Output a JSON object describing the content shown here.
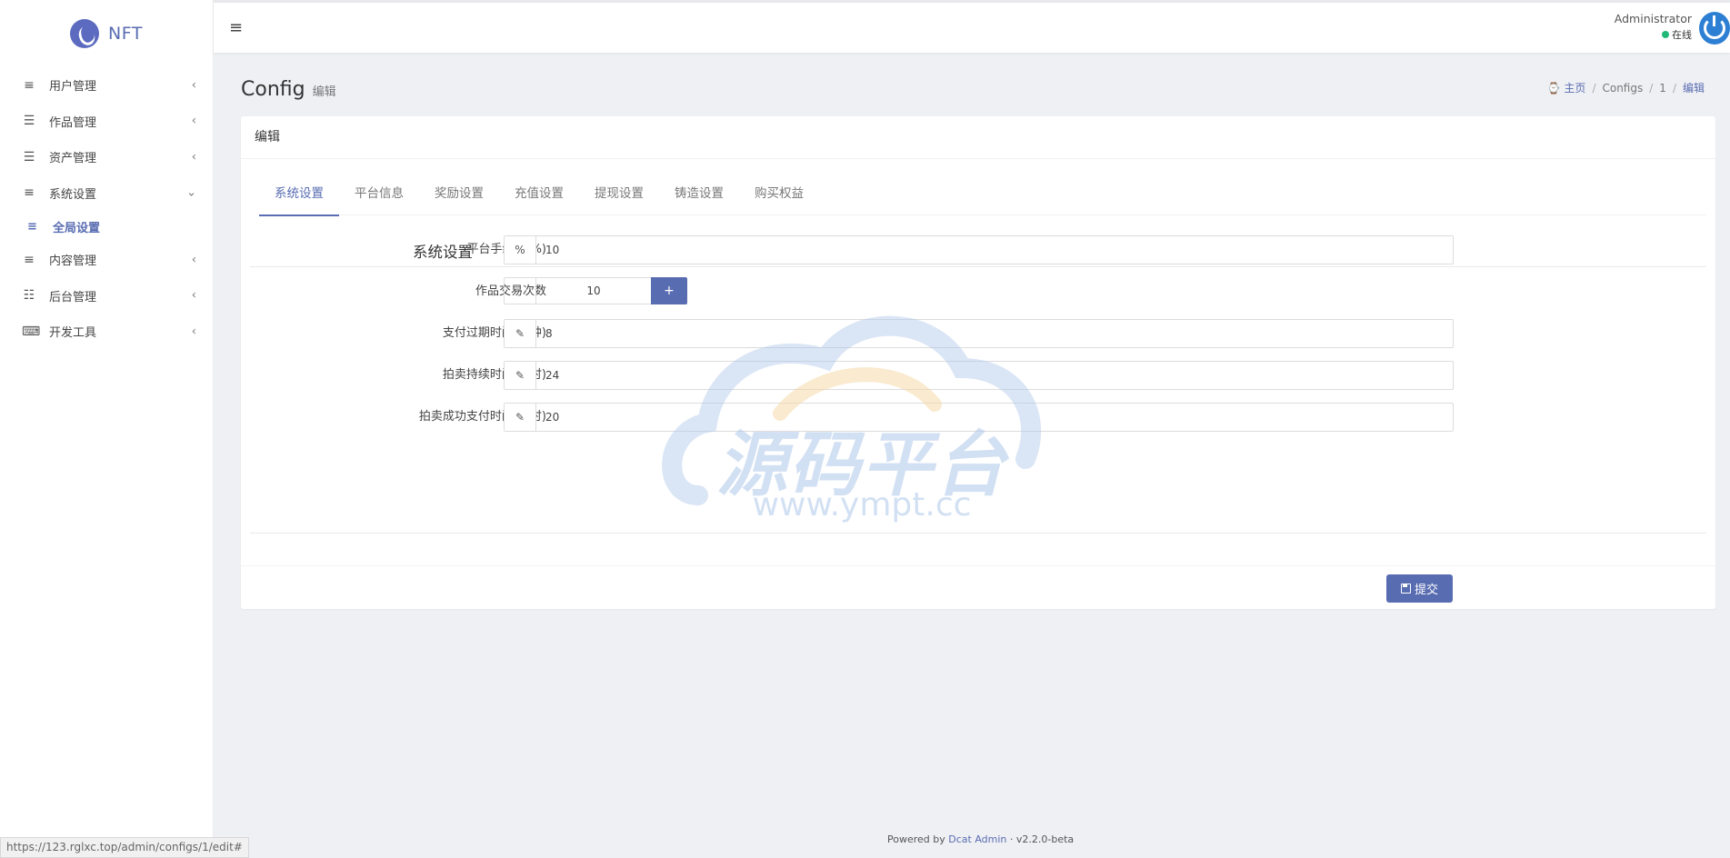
{
  "brand": {
    "name": "NFT"
  },
  "sidebar": {
    "items": [
      {
        "label": "用户管理",
        "icon": "bars-icon"
      },
      {
        "label": "作品管理",
        "icon": "list-icon"
      },
      {
        "label": "资产管理",
        "icon": "list-icon"
      },
      {
        "label": "系统设置",
        "icon": "bars-icon"
      },
      {
        "label": "内容管理",
        "icon": "bars-icon"
      },
      {
        "label": "后台管理",
        "icon": "server-icon"
      },
      {
        "label": "开发工具",
        "icon": "keyboard-icon"
      }
    ],
    "sub_item": {
      "label": "全局设置",
      "icon": "bars-icon"
    }
  },
  "header": {
    "user_name": "Administrator",
    "status": "在线"
  },
  "page": {
    "title": "Config",
    "description": "编辑"
  },
  "breadcrumb": {
    "home": "主页",
    "section": "Configs",
    "id": "1",
    "current": "编辑"
  },
  "card": {
    "title": "编辑"
  },
  "tabs": [
    "系统设置",
    "平台信息",
    "奖励设置",
    "充值设置",
    "提现设置",
    "铸造设置",
    "购买权益"
  ],
  "form": {
    "section_title": "系统设置",
    "fee": {
      "label": "平台手续费(%)",
      "addon": "%",
      "value": "10"
    },
    "trades": {
      "label": "作品交易次数",
      "minus": "-",
      "value": "10",
      "plus": "+"
    },
    "pay_expire": {
      "label": "支付过期时间(分钟)",
      "value": "8"
    },
    "auction_duration": {
      "label": "拍卖持续时间(小时)",
      "value": "24"
    },
    "auction_pay": {
      "label": "拍卖成功支付时间(小时)",
      "value": "20"
    },
    "submit": "提交"
  },
  "watermark": {
    "text": "源码平台",
    "url": "www.ympt.cc"
  },
  "footer": {
    "powered": "Powered by",
    "link": "Dcat Admin",
    "version": "v2.2.0-beta"
  },
  "status_url": "https://123.rglxc.top/admin/configs/1/edit#",
  "colors": {
    "accent": "#586cb1",
    "online": "#21b978",
    "background": "#eff0f4"
  }
}
